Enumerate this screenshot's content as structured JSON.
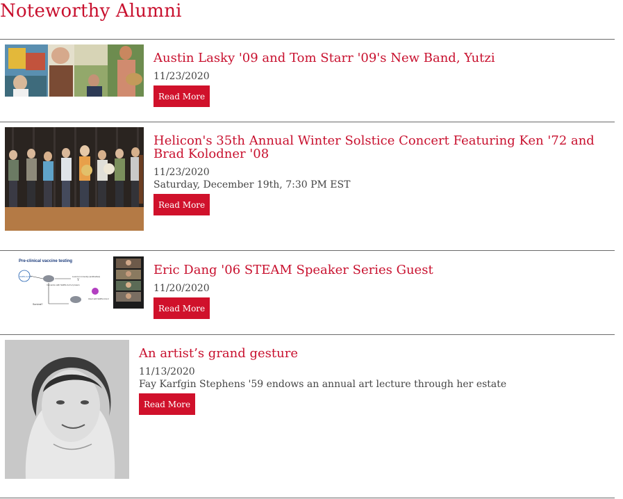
{
  "page": {
    "title": "Noteworthy Alumni"
  },
  "items": [
    {
      "title": "Austin Lasky '09 and Tom Starr '09's New Band, Yutzi",
      "date": "11/23/2020",
      "subtitle": "",
      "button": "Read More",
      "image_alt": "Band members of Yutzi playing instruments"
    },
    {
      "title": "Helicon's 35th Annual Winter Solstice Concert Featuring Ken '72 and Brad Kolodner '08",
      "date": "11/23/2020",
      "subtitle": "Saturday, December 19th, 7:30 PM EST",
      "button": "Read More",
      "image_alt": "Helicon ensemble on stage with instruments"
    },
    {
      "title": "Eric Dang '06 STEAM Speaker Series Guest",
      "date": "11/20/2020",
      "subtitle": "",
      "button": "Read More",
      "image_alt": "Pre-clinical vaccine testing slide with video call participants",
      "diagram": {
        "heading": "Pre-clinical vaccine testing",
        "labels": [
          "SARS-CoV-2",
          "Look for immunity (antibodies)",
          "Immunize with SARS-CoV-2 protein",
          "Survival?",
          "Infect with SARS-CoV-2"
        ]
      }
    },
    {
      "title": "An artist’s grand gesture",
      "date": "11/13/2020",
      "subtitle": "Fay Karfgin Stephens '59 endows an annual art lecture through her estate",
      "button": "Read More",
      "image_alt": "Black and white yearbook portrait"
    }
  ],
  "colors": {
    "accent": "#c8102e",
    "button": "#d0112b",
    "rule": "#6a6a6a"
  }
}
